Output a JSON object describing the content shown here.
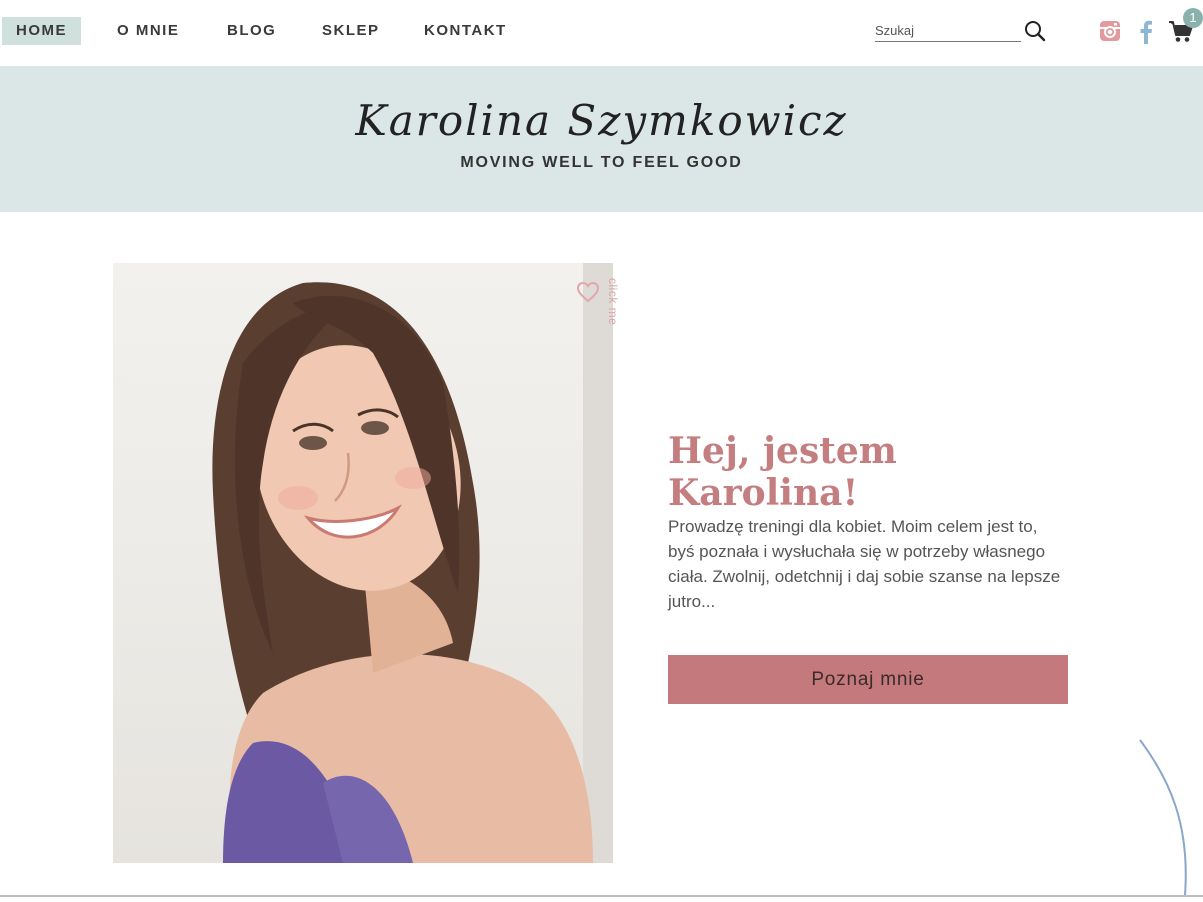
{
  "nav": {
    "items": [
      {
        "label": "HOME",
        "active": true
      },
      {
        "label": "O MNIE"
      },
      {
        "label": "BLOG"
      },
      {
        "label": "SKLEP"
      },
      {
        "label": "KONTAKT"
      }
    ],
    "search_placeholder": "Szukaj",
    "cart_count": "1",
    "icons": [
      "search-icon",
      "instagram-icon",
      "facebook-icon",
      "cart-icon"
    ]
  },
  "header": {
    "brand": "Karolina Szymkowicz",
    "tagline": "MOVING WELL TO FEEL GOOD"
  },
  "main": {
    "click_me": "click me",
    "title": "Hej, jestem Karolina!",
    "text": "Prowadzę treningi dla kobiet. Moim celem jest to, byś poznała i wysłuchała się w potrzeby własnego ciała. Zwolnij, odetchnij i daj sobie szanse na lepsze jutro...",
    "cta": "Poznaj mnie"
  },
  "colors": {
    "accent": "#c4797d",
    "nav_active": "#cfe0dd",
    "header_band": "#dbe7e7",
    "badge": "#89b2ad"
  }
}
